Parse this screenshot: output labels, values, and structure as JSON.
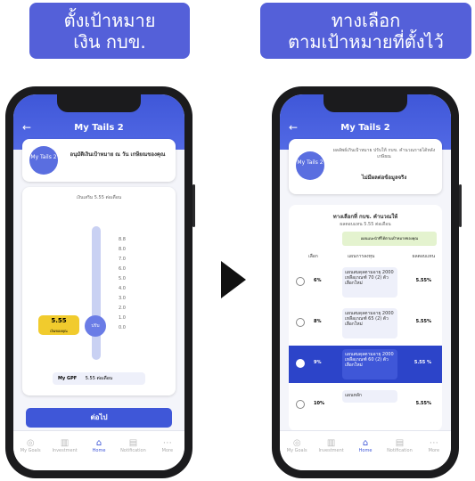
{
  "left_badge": {
    "line1": "ตั้งเป้าหมาย",
    "line2": "เงิน กบข."
  },
  "right_badge": {
    "line1": "ทางเลือก",
    "line2": "ตามเป้าหมายที่ตั้งไว้"
  },
  "left_screen": {
    "title": "My Tails 2",
    "avatar_label": "My Tails 2",
    "card_text": "อนุมัติเงินเป้าหมาย ณ วัน เกษียณของคุณ",
    "rate_caption": "เงินเสริม 5.55 ต่อเดือน",
    "my_rate_value": "5.55",
    "my_rate_label": "เงินของคุณ",
    "knob_label": "ปรับ",
    "scale": [
      "8.8",
      "8.0",
      "7.0",
      "6.0",
      "5.0",
      "4.0",
      "3.0",
      "2.0",
      "1.0",
      "0.0"
    ],
    "my_gpf_label": "My GPF",
    "my_gpf_value": "5.55 ต่อเดือน",
    "cta": "ต่อไป"
  },
  "right_screen": {
    "title": "My Tails 2",
    "avatar_label": "My Tails 2",
    "card_text": "ผลลัพธ์เกินเป้าหมาย ปรับให้ กบข. คำนวณรายได้หลังเกษียณ",
    "card_action": "ไม่มีผลต่อข้อมูลจริง",
    "section_title": "ทางเลือกที่ กบข. คำนวณให้",
    "section_sub": "ผลตอบแทน 5.55 ต่อเดือน",
    "col_headers": [
      "เลือก",
      "แผนการลงทุน",
      "ผลตอบแทน"
    ],
    "banner": "แผนแนะนำที่ได้ตามเป้าหมายของคุณ",
    "rows": [
      {
        "pct": "6%",
        "fund": "แผนสมดุลตามอายุ 2000 เหลือเกณฑ์ 70 (2) ตัวเลือกใหม่",
        "ret": "5.55%"
      },
      {
        "pct": "8%",
        "fund": "แผนสมดุลตามอายุ 2000 เหลือเกณฑ์ 65 (2) ตัวเลือกใหม่",
        "ret": "5.55%"
      },
      {
        "pct": "9%",
        "fund": "แผนสมดุลตามอายุ 2000 เหลือเกณฑ์ 60 (2) ตัวเลือกใหม่",
        "ret": "5.55 %"
      },
      {
        "pct": "10%",
        "fund": "แผนหลัก",
        "ret": "5.55%"
      }
    ]
  },
  "nav": [
    "My Goals",
    "Investment",
    "Home",
    "Notification",
    "More"
  ]
}
